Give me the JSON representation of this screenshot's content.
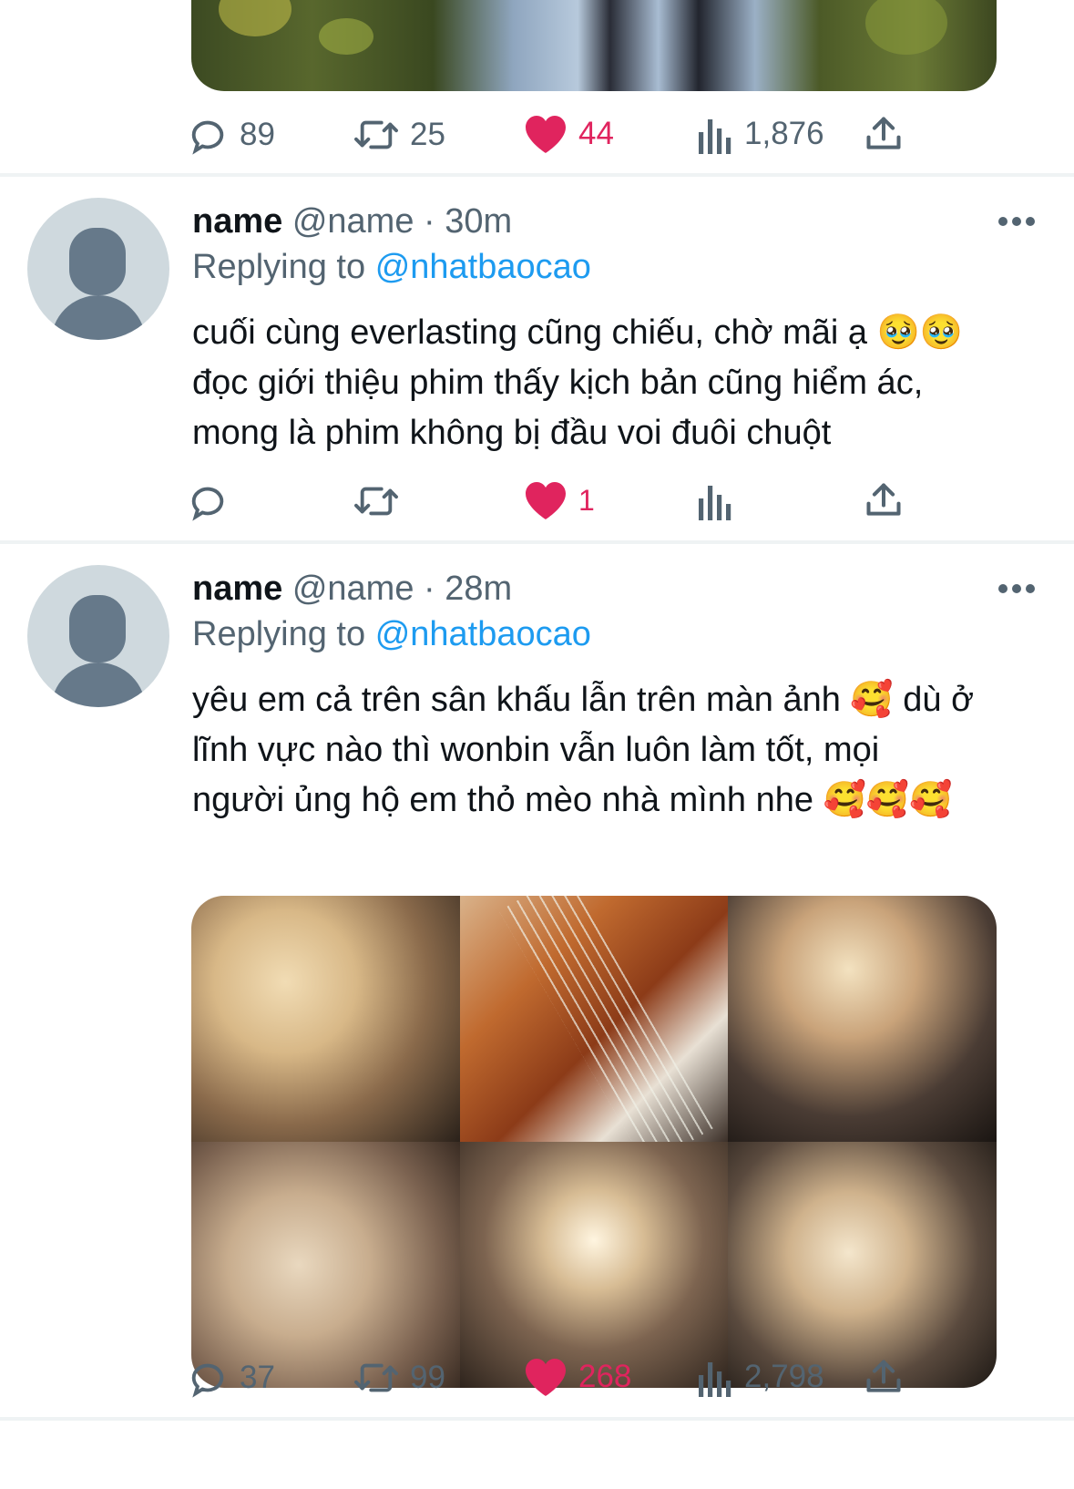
{
  "top_tweet": {
    "actions": {
      "replies": "89",
      "retweets": "25",
      "likes": "44",
      "views": "1,876"
    }
  },
  "tweets": [
    {
      "display_name": "name",
      "handle": "@name",
      "time": "· 30m",
      "replying_prefix": "Replying to",
      "replying_to": "@nhatbaocao",
      "lines": [
        "cuối cùng everlasting cũng chiếu, chờ mãi ạ 🥹🥹",
        "đọc giới thiệu phim thấy kịch bản cũng hiểm ác,",
        "mong là phim không bị đầu voi đuôi chuột"
      ],
      "actions": {
        "replies": "",
        "retweets": "",
        "likes": "1",
        "views": ""
      }
    },
    {
      "display_name": "name",
      "handle": "@name",
      "time": "· 28m",
      "replying_prefix": "Replying to",
      "replying_to": "@nhatbaocao",
      "lines": [
        "yêu em cả trên sân khấu lẫn trên màn ảnh 🥰  dù ở",
        "lĩnh vực nào thì wonbin vẫn luôn làm tốt, mọi",
        "người ủng hộ em thỏ mèo nhà mình nhe 🥰🥰🥰"
      ],
      "actions": {
        "replies": "37",
        "retweets": "99",
        "likes": "268",
        "views": "2,798"
      }
    }
  ],
  "icons": {
    "reply": "speech-bubble-icon",
    "retweet": "retweet-arrows-icon",
    "like": "heart-icon",
    "views": "bar-chart-icon",
    "share": "share-upload-icon",
    "more": "more-dots-icon"
  },
  "colors": {
    "like": "#e0245e",
    "mention": "#1d9bf0",
    "secondary_text": "#536471",
    "avatar_bg": "#cfd9de"
  }
}
